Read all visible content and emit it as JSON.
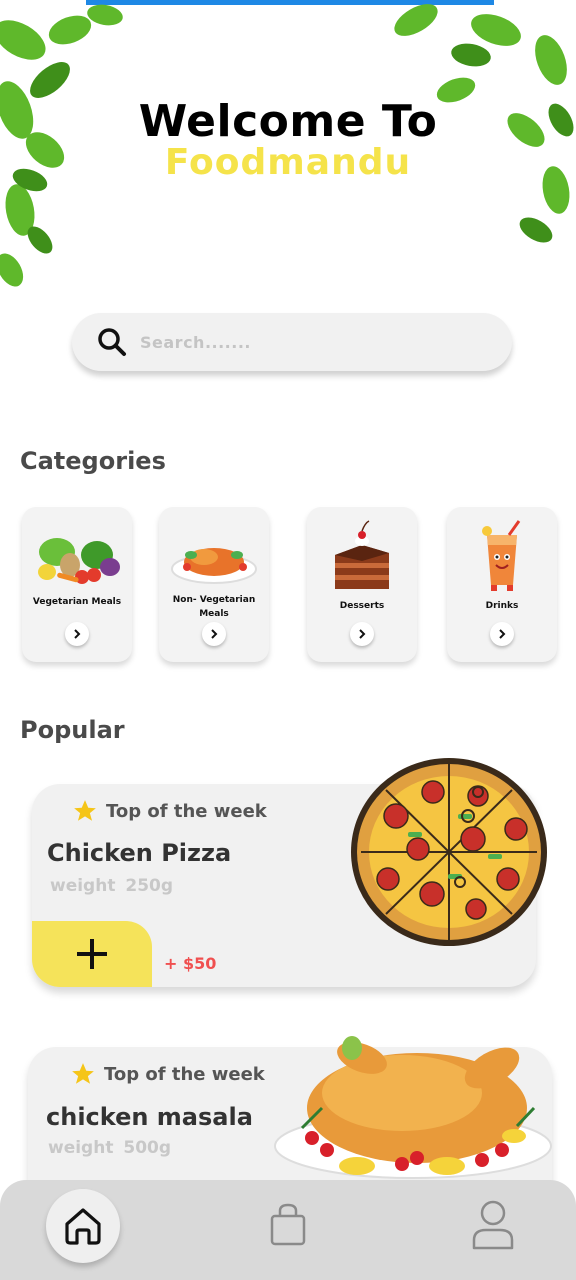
{
  "header": {
    "welcome": "Welcome To",
    "brand": "Foodmandu",
    "brand_color": "#f5e34a"
  },
  "search": {
    "placeholder": "Search.......",
    "icon": "search-icon"
  },
  "categories": {
    "title": "Categories",
    "items": [
      {
        "label": "Vegetarian Meals",
        "image": "vegetables-image"
      },
      {
        "label": "Non- Vegetarian Meals",
        "image": "roast-chicken-image"
      },
      {
        "label": "Desserts",
        "image": "cake-image"
      },
      {
        "label": "Drinks",
        "image": "juice-image"
      }
    ]
  },
  "popular": {
    "title": "Popular",
    "items": [
      {
        "badge": "Top of the week",
        "name": "Chicken Pizza",
        "weight": "weight 250g",
        "price": "+ $50",
        "image": "pizza-image"
      },
      {
        "badge": "Top of the week",
        "name": "chicken masala",
        "weight": "weight 500g",
        "image": "roast-chicken-image"
      }
    ]
  },
  "nav": {
    "items": [
      "home-icon",
      "bag-icon",
      "user-icon"
    ],
    "active": "home-icon"
  }
}
